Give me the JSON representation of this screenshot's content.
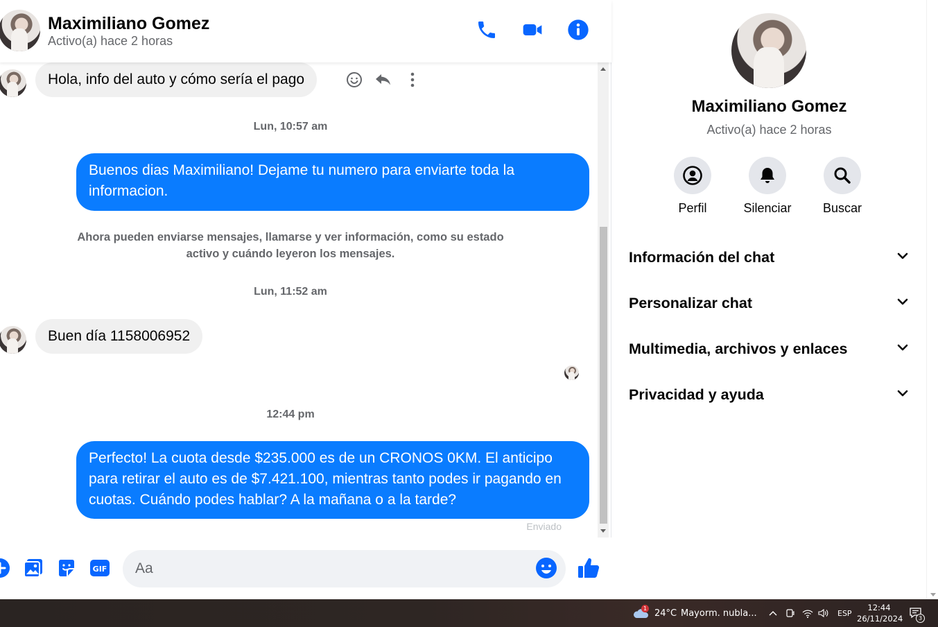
{
  "header": {
    "contact_name": "Maximiliano Gomez",
    "status": "Activo(a) hace 2 horas",
    "icons": [
      "phone-icon",
      "video-icon",
      "info-icon"
    ]
  },
  "messages": {
    "msg1": "Hola, info del auto y cómo sería el pago",
    "ts1": "Lun, 10:57 am",
    "msg2": "Buenos dias Maximiliano! Dejame tu numero para enviarte toda la informacion.",
    "notice": "Ahora pueden enviarse mensajes, llamarse y ver información, como su estado activo y cuándo leyeron los mensajes.",
    "ts2": "Lun, 11:52 am",
    "msg3": "Buen día 1158006952",
    "ts3": "12:44 pm",
    "msg4": "Perfecto! La cuota desde $235.000 es de un CRONOS 0KM. El anticipo para retirar el auto es de $7.421.100, mientras tanto podes ir pagando en cuotas. Cuándo podes hablar? A la mañana o a la tarde?",
    "sent_label": "Enviado"
  },
  "composer": {
    "placeholder": "Aa",
    "icons": [
      "plus-icon",
      "image-icon",
      "sticker-icon",
      "gif-icon",
      "emoji-icon",
      "like-icon"
    ]
  },
  "info_panel": {
    "name": "Maximiliano Gomez",
    "status": "Activo(a) hace 2 horas",
    "actions": [
      {
        "label": "Perfil"
      },
      {
        "label": "Silenciar"
      },
      {
        "label": "Buscar"
      }
    ],
    "sections": [
      {
        "label": "Información del chat"
      },
      {
        "label": "Personalizar chat"
      },
      {
        "label": "Multimedia, archivos y enlaces"
      },
      {
        "label": "Privacidad y ayuda"
      }
    ]
  },
  "taskbar": {
    "temperature": "24°C",
    "weather": "Mayorm. nubla...",
    "weather_badge": "1",
    "language": "ESP",
    "time": "12:44",
    "date": "26/11/2024",
    "notifications": "3"
  },
  "colors": {
    "accent": "#0a7cff",
    "icon_blue": "#0866ff",
    "incoming_bubble": "#f0f0f0"
  }
}
